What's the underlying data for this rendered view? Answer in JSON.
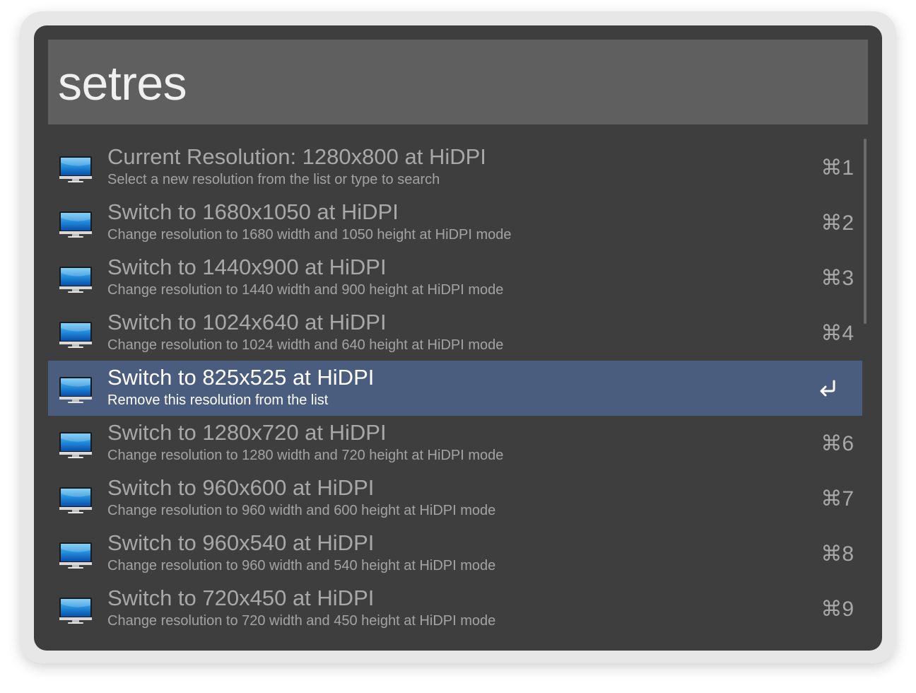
{
  "search": {
    "query": "setres"
  },
  "results": [
    {
      "title": "Current Resolution: 1280x800 at HiDPI",
      "subtitle": "Select a new resolution from the list or type to search",
      "shortcut": "⌘1",
      "icon": "monitor-icon",
      "selected": false
    },
    {
      "title": "Switch to 1680x1050 at HiDPI",
      "subtitle": "Change resolution to 1680 width and 1050 height at HiDPI mode",
      "shortcut": "⌘2",
      "icon": "monitor-icon",
      "selected": false
    },
    {
      "title": "Switch to 1440x900 at HiDPI",
      "subtitle": "Change resolution to 1440 width and 900 height at HiDPI mode",
      "shortcut": "⌘3",
      "icon": "monitor-icon",
      "selected": false
    },
    {
      "title": "Switch to 1024x640 at HiDPI",
      "subtitle": "Change resolution to 1024 width and 640 height at HiDPI mode",
      "shortcut": "⌘4",
      "icon": "monitor-icon",
      "selected": false
    },
    {
      "title": "Switch to 825x525 at HiDPI",
      "subtitle": "Remove this resolution from the list",
      "shortcut": "",
      "icon": "monitor-icon",
      "selected": true
    },
    {
      "title": "Switch to 1280x720 at HiDPI",
      "subtitle": "Change resolution to 1280 width and 720 height at HiDPI mode",
      "shortcut": "⌘6",
      "icon": "monitor-icon",
      "selected": false
    },
    {
      "title": "Switch to 960x600 at HiDPI",
      "subtitle": "Change resolution to 960 width and 600 height at HiDPI mode",
      "shortcut": "⌘7",
      "icon": "monitor-icon",
      "selected": false
    },
    {
      "title": "Switch to 960x540 at HiDPI",
      "subtitle": "Change resolution to 960 width and 540 height at HiDPI mode",
      "shortcut": "⌘8",
      "icon": "monitor-icon",
      "selected": false
    },
    {
      "title": "Switch to 720x450 at HiDPI",
      "subtitle": "Change resolution to 720 width and 450 height at HiDPI mode",
      "shortcut": "⌘9",
      "icon": "monitor-icon",
      "selected": false
    }
  ],
  "selected_action_icon": "return-icon",
  "colors": {
    "window_background": "#3e3e3e",
    "search_background": "#5f5f5f",
    "selection_background": "#4b5d7e",
    "text": "#a8a8a8",
    "selected_text": "#ffffff"
  }
}
